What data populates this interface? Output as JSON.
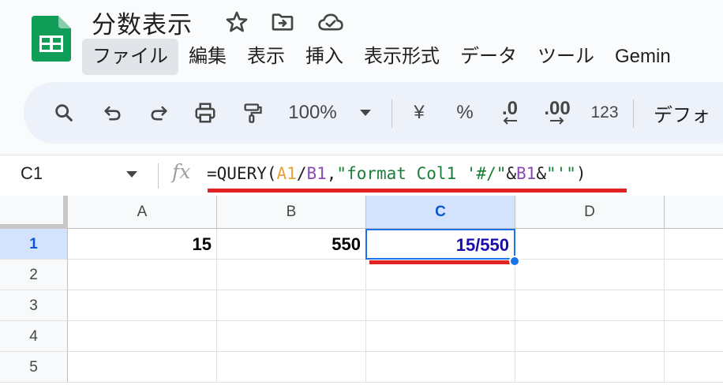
{
  "document": {
    "title": "分数表示"
  },
  "title_icons": [
    "star-icon",
    "move-to-folder-icon",
    "cloud-saved-icon"
  ],
  "menu": [
    "ファイル",
    "編集",
    "表示",
    "挿入",
    "表示形式",
    "データ",
    "ツール",
    "Gemin"
  ],
  "toolbar": {
    "zoom": "100%",
    "currency": "¥",
    "percent": "%",
    "decrease_decimal": ".0",
    "increase_decimal": ".00",
    "number_format": "123",
    "font": "デフォ"
  },
  "formula_bar": {
    "cell_ref": "C1",
    "fx": "fx",
    "formula_parts": {
      "p1": "=QUERY(",
      "p2": "A1",
      "p3": "/",
      "p4": "B1",
      "p5": ",",
      "p6": "\"format Col1 '#/\"",
      "p7": "&",
      "p8": "B1",
      "p9": "&",
      "p10": "\"'\"",
      "p11": ")"
    }
  },
  "grid": {
    "columns": [
      "A",
      "B",
      "C",
      "D"
    ],
    "rows": [
      "1",
      "2",
      "3",
      "4",
      "5"
    ],
    "cells": {
      "A1": "15",
      "B1": "550",
      "C1": "15/550"
    },
    "selected_cell": "C1"
  },
  "colors": {
    "accent": "#1a73e8",
    "annotation_underline": "#e02424",
    "ref_a1": "#e8a13b",
    "ref_b1": "#8a4bb4",
    "string": "#188038"
  }
}
